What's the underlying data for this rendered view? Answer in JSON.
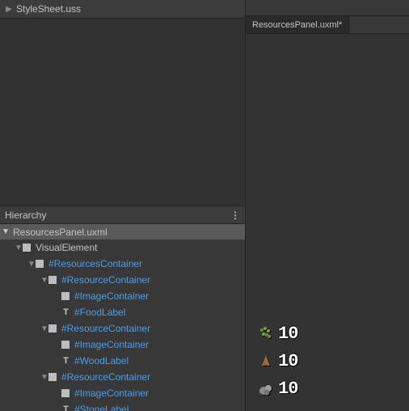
{
  "stylesheet_bar": {
    "title": "StyleSheet.uss"
  },
  "hierarchy_header": {
    "title": "Hierarchy"
  },
  "tree": {
    "root_label": "ResourcesPanel.uxml",
    "rows": [
      {
        "indent": 1,
        "tri": true,
        "icon": "sq",
        "label": "VisualElement",
        "link": false
      },
      {
        "indent": 2,
        "tri": true,
        "icon": "sq",
        "label": "#ResourcesContainer",
        "link": true
      },
      {
        "indent": 3,
        "tri": true,
        "icon": "sq",
        "label": "#ResourceContainer",
        "link": true
      },
      {
        "indent": 4,
        "tri": false,
        "icon": "sq",
        "label": "#ImageContainer",
        "link": true
      },
      {
        "indent": 4,
        "tri": false,
        "icon": "t",
        "label": "#FoodLabel",
        "link": true
      },
      {
        "indent": 3,
        "tri": true,
        "icon": "sq",
        "label": "#ResourceContainer",
        "link": true
      },
      {
        "indent": 4,
        "tri": false,
        "icon": "sq",
        "label": "#ImageContainer",
        "link": true
      },
      {
        "indent": 4,
        "tri": false,
        "icon": "t",
        "label": "#WoodLabel",
        "link": true
      },
      {
        "indent": 3,
        "tri": true,
        "icon": "sq",
        "label": "#ResourceContainer",
        "link": true
      },
      {
        "indent": 4,
        "tri": false,
        "icon": "sq",
        "label": "#ImageContainer",
        "link": true
      },
      {
        "indent": 4,
        "tri": false,
        "icon": "t",
        "label": "#StoneLabel",
        "link": true
      }
    ]
  },
  "right_tab": {
    "label": "ResourcesPanel.uxml*"
  },
  "resources": {
    "food": {
      "value": "10"
    },
    "wood": {
      "value": "10"
    },
    "stone": {
      "value": "10"
    }
  }
}
